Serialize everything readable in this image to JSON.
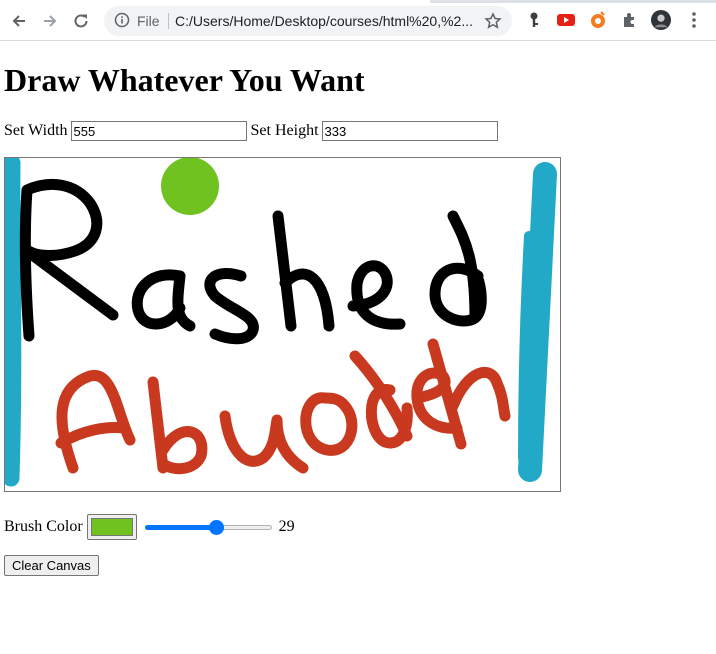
{
  "browser": {
    "file_label": "File",
    "url": "C:/Users/Home/Desktop/courses/html%20,%2..."
  },
  "page": {
    "heading": "Draw Whatever You Want",
    "width_label": "Set Width",
    "width_value": "555",
    "height_label": "Set Height",
    "height_value": "333",
    "brush_label": "Brush Color",
    "brush_color": "#6fc21f",
    "brush_size": 29,
    "brush_size_min": 1,
    "brush_size_max": 50,
    "clear_button": "Clear Canvas"
  },
  "canvas_drawing": {
    "text_line_1": "Rashed",
    "text_line_2": "Abuodeh",
    "colors": {
      "black": "#000000",
      "red": "#c8391f",
      "cyan": "#22a9c7",
      "green": "#6fc21f"
    }
  }
}
